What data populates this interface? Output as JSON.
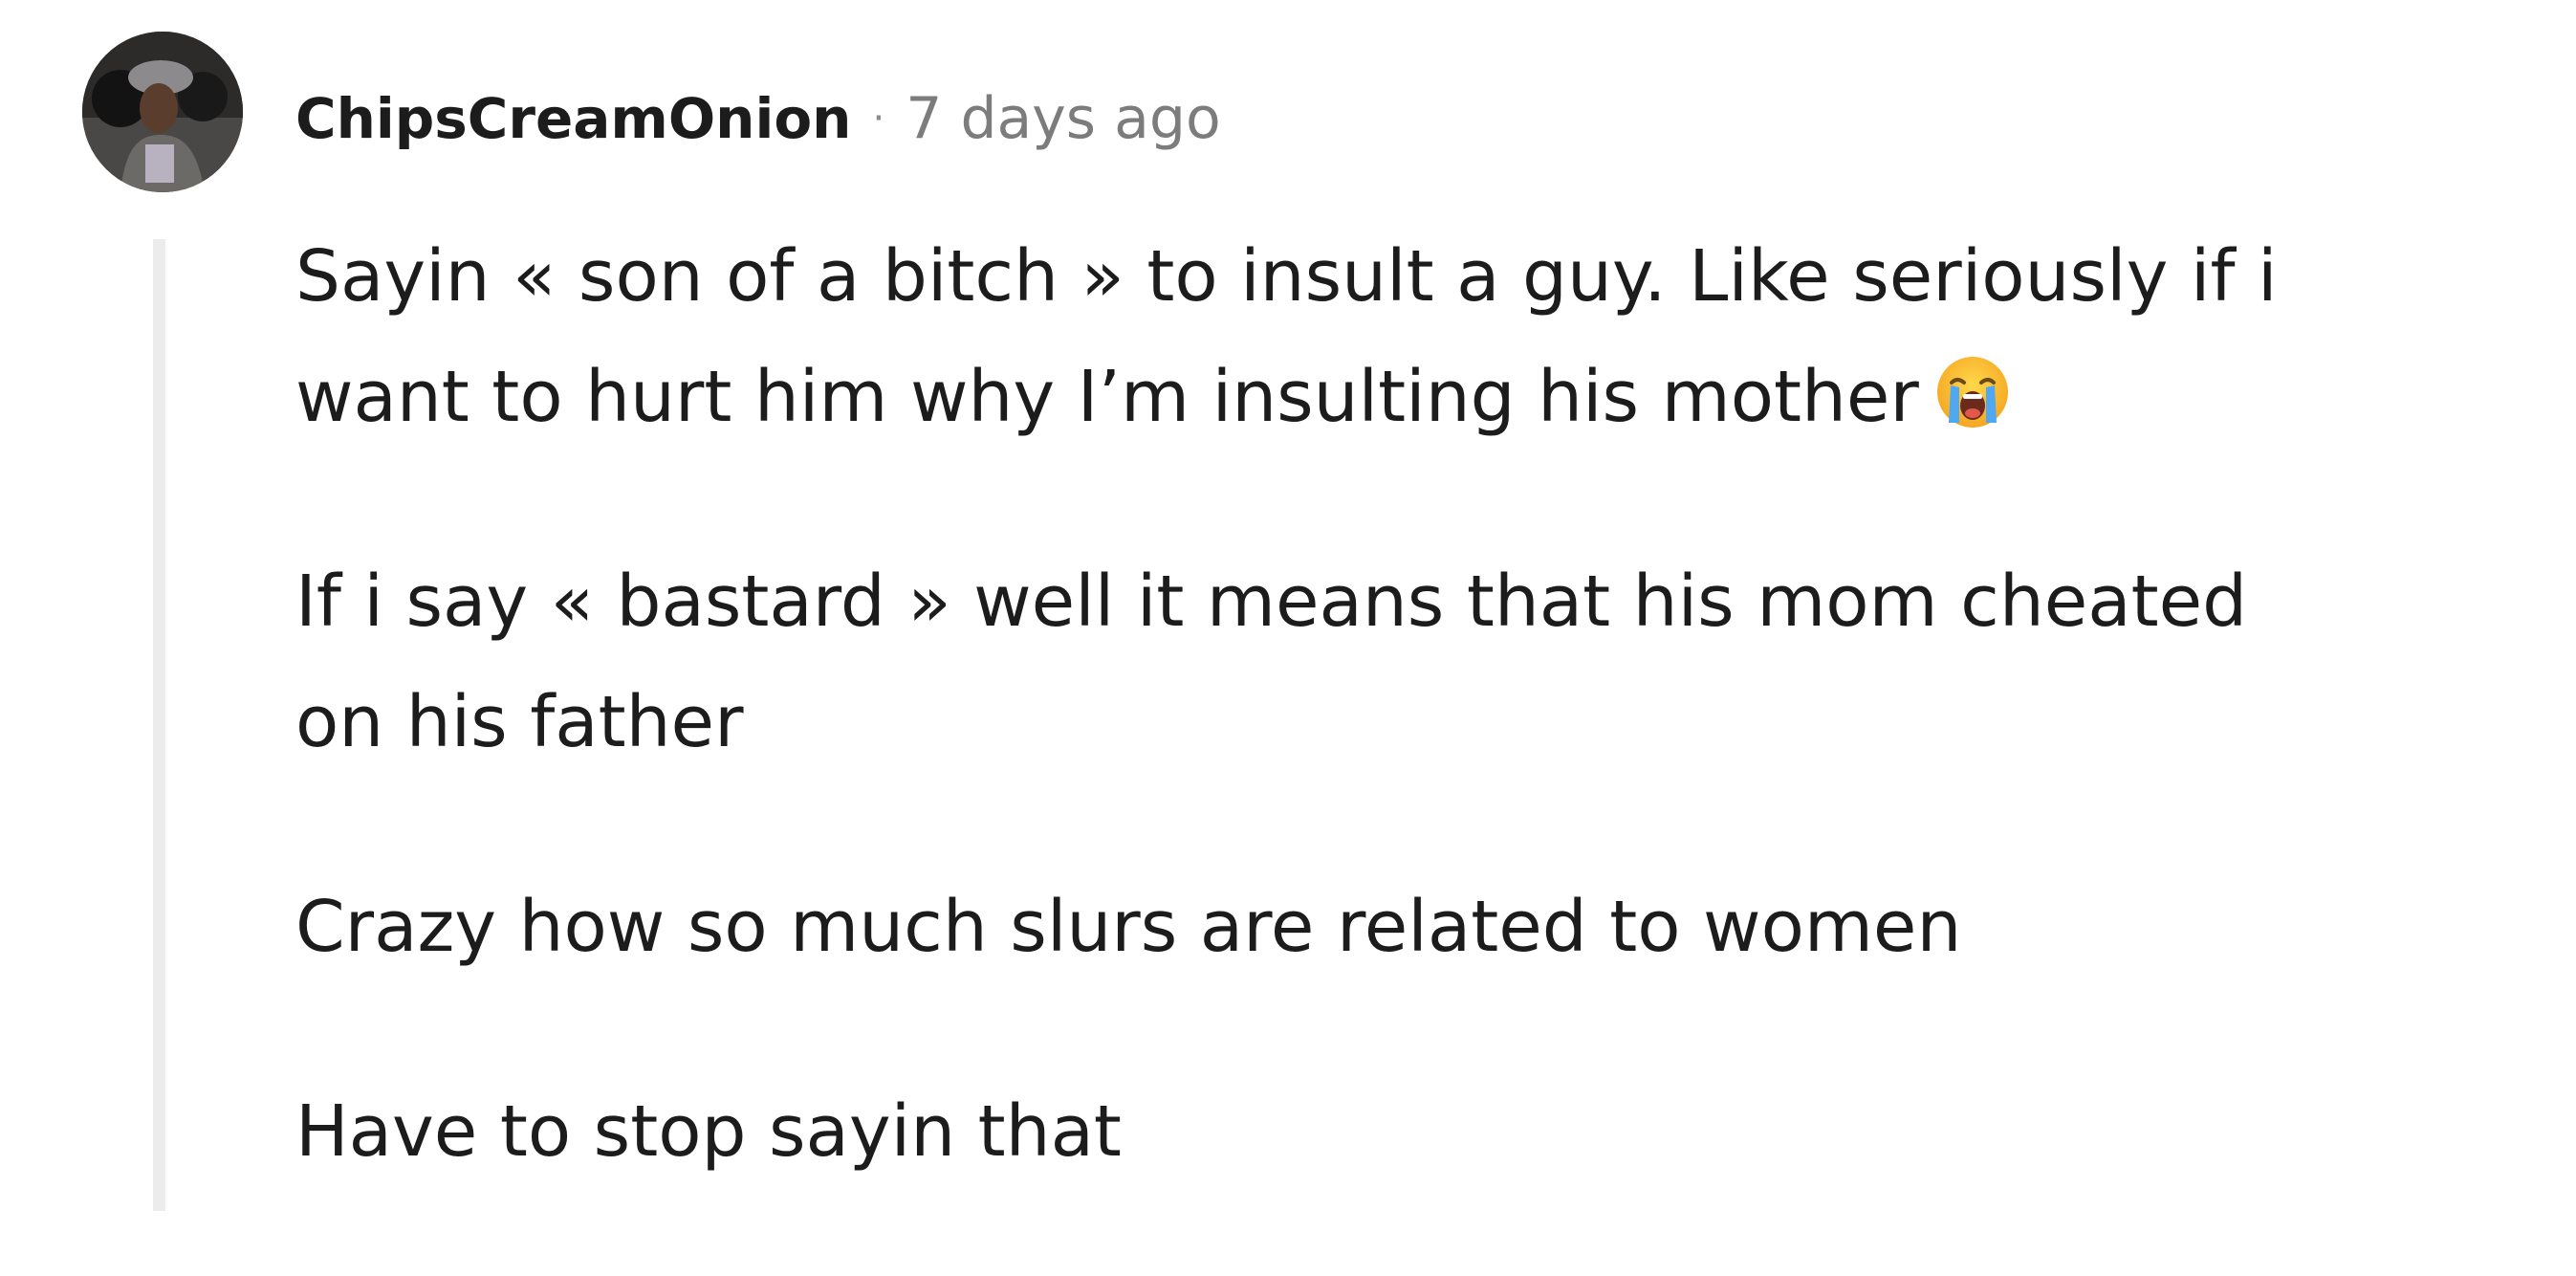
{
  "comment": {
    "author": "ChipsCreamOnion",
    "separator": "·",
    "timestamp": "7 days ago",
    "avatar_icon": "user-avatar-photo",
    "paragraphs": [
      {
        "line1": "Sayin « son of a bitch » to insult a guy. Like seriously if i",
        "line2": "want to hurt him why I’m insulting his mother",
        "emoji": "loudly-crying-face-icon"
      },
      {
        "line1": "If i say « bastard » well it means that his mom cheated",
        "line2": "on his father"
      },
      {
        "line1": "Crazy how so much slurs are related to women"
      },
      {
        "line1": "Have to stop sayin that"
      }
    ]
  },
  "colors": {
    "text": "#1c1c1c",
    "meta": "#7c7c7c",
    "thread_line": "#ececec",
    "background": "#ffffff"
  }
}
